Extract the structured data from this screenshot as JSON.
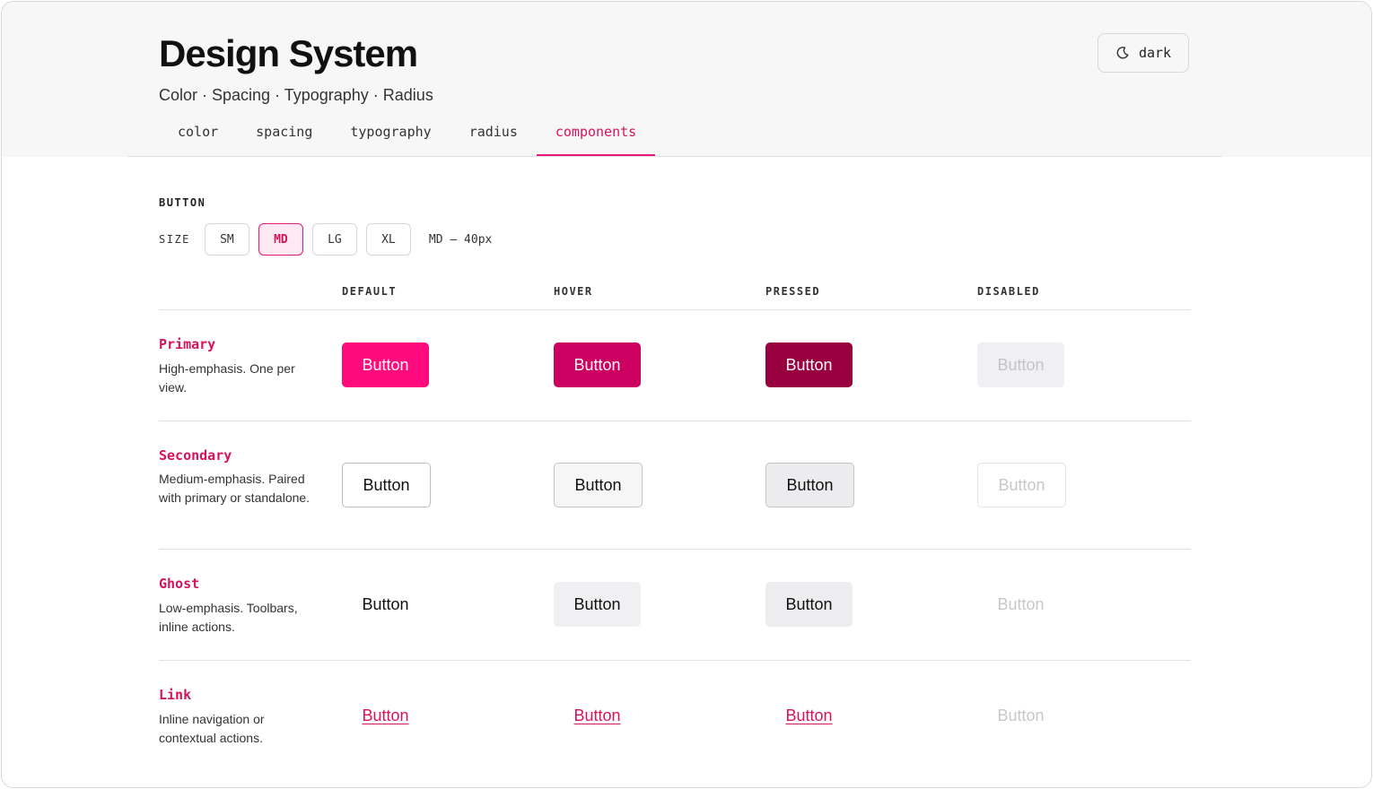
{
  "header": {
    "title": "Design System",
    "subtitle": "Color · Spacing · Typography · Radius",
    "theme_toggle": {
      "icon": "moon-icon",
      "label": "dark"
    }
  },
  "tabs": [
    {
      "label": "color",
      "active": false
    },
    {
      "label": "spacing",
      "active": false
    },
    {
      "label": "typography",
      "active": false
    },
    {
      "label": "radius",
      "active": false
    },
    {
      "label": "components",
      "active": true
    }
  ],
  "section": {
    "label": "BUTTON",
    "size_label": "SIZE",
    "sizes": [
      "SM",
      "MD",
      "LG",
      "XL"
    ],
    "selected_size": "MD",
    "size_readout": "MD — 40px"
  },
  "columns": [
    "DEFAULT",
    "HOVER",
    "PRESSED",
    "DISABLED"
  ],
  "variants": [
    {
      "name": "Primary",
      "description": "High-emphasis. One per view.",
      "button_label": "Button"
    },
    {
      "name": "Secondary",
      "description": "Medium-emphasis. Paired with primary or standalone.",
      "button_label": "Button"
    },
    {
      "name": "Ghost",
      "description": "Low-emphasis. Toolbars, inline actions.",
      "button_label": "Button"
    },
    {
      "name": "Link",
      "description": "Inline navigation or contextual actions.",
      "button_label": "Button"
    }
  ],
  "colors": {
    "accent": "#e8187a",
    "primary_default": "#ff0a7c",
    "primary_hover": "#cc0061",
    "primary_pressed": "#99003f",
    "disabled_text": "#c8c8cc"
  }
}
